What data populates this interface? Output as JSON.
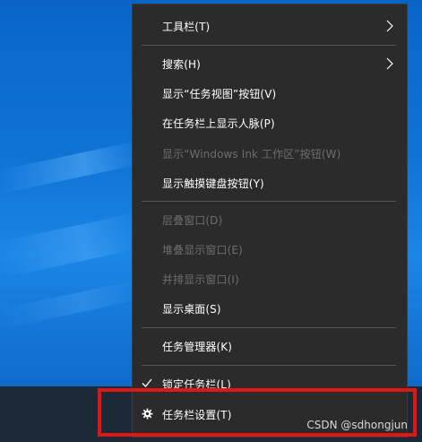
{
  "colors": {
    "menu_background": "#2b2b2b",
    "menu_text": "#ffffff",
    "menu_disabled_text": "#6e6e6e",
    "separator": "#565656",
    "highlight_border": "#e31515",
    "taskbar": "#1b2a36"
  },
  "context_menu": {
    "items": [
      {
        "label": "工具栏(T)",
        "enabled": true,
        "submenu": true
      },
      {
        "label": "搜索(H)",
        "enabled": true,
        "submenu": true
      },
      {
        "label": "显示“任务视图”按钮(V)",
        "enabled": true
      },
      {
        "label": "在任务栏上显示人脉(P)",
        "enabled": true
      },
      {
        "label": "显示“Windows Ink 工作区”按钮(W)",
        "enabled": false
      },
      {
        "label": "显示触摸键盘按钮(Y)",
        "enabled": true
      },
      {
        "label": "层叠窗口(D)",
        "enabled": false
      },
      {
        "label": "堆叠显示窗口(E)",
        "enabled": false
      },
      {
        "label": "并排显示窗口(I)",
        "enabled": false
      },
      {
        "label": "显示桌面(S)",
        "enabled": true
      },
      {
        "label": "任务管理器(K)",
        "enabled": true
      },
      {
        "label": "锁定任务栏(L)",
        "enabled": true,
        "checked": true,
        "icon": "check-icon"
      },
      {
        "label": "任务栏设置(T)",
        "enabled": true,
        "icon": "gear-icon"
      }
    ]
  },
  "watermark": "CSDN @sdhongjun"
}
